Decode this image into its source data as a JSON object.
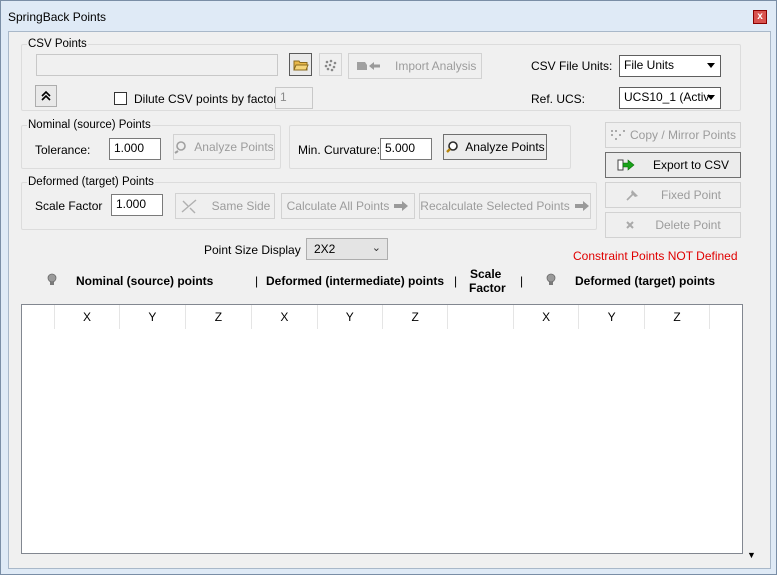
{
  "window": {
    "title": "SpringBack Points",
    "close_glyph": "x"
  },
  "csv": {
    "group_label": "CSV Points",
    "path_value": "",
    "import_label": "Import Analysis",
    "dilute_label": "Dilute CSV points by factor:",
    "dilute_value": "1",
    "file_units_label": "CSV File Units:",
    "file_units_value": "File Units",
    "ref_ucs_label": "Ref. UCS:",
    "ref_ucs_value": "UCS10_1  (Activ"
  },
  "nominal": {
    "group_label": "Nominal (source) Points",
    "tolerance_label": "Tolerance:",
    "tolerance_value": "1.000",
    "analyze_disabled_label": "Analyze Points",
    "min_curvature_label": "Min. Curvature:",
    "min_curvature_value": "5.000",
    "analyze_label": "Analyze Points"
  },
  "deformed": {
    "group_label": "Deformed (target) Points",
    "scale_factor_label": "Scale Factor",
    "scale_factor_value": "1.000",
    "same_side_label": "Same Side",
    "calc_all_label": "Calculate All Points",
    "recalc_label": "Recalculate Selected Points"
  },
  "side_buttons": {
    "copy_mirror": "Copy / Mirror Points",
    "export_csv": "Export to CSV",
    "fixed_point": "Fixed Point",
    "delete_point": "Delete Point"
  },
  "point_size": {
    "label": "Point Size Display",
    "value": "2X2"
  },
  "constraint_warning": "Constraint Points NOT Defined",
  "headers": {
    "nominal": "Nominal (source) points",
    "sep1": "|",
    "intermediate": "Deformed (intermediate) points",
    "sep2": "|",
    "scale_line1": "Scale",
    "scale_line2": "Factor",
    "sep3": "|",
    "target": "Deformed (target) points"
  },
  "grid": {
    "columns": [
      "",
      "X",
      "Y",
      "Z",
      "X",
      "Y",
      "Z",
      "",
      "X",
      "Y",
      "Z",
      ""
    ]
  },
  "scroll_indicator": "▼",
  "colors": {
    "warning": "#e00000",
    "export_arrow": "#1aa31a"
  }
}
